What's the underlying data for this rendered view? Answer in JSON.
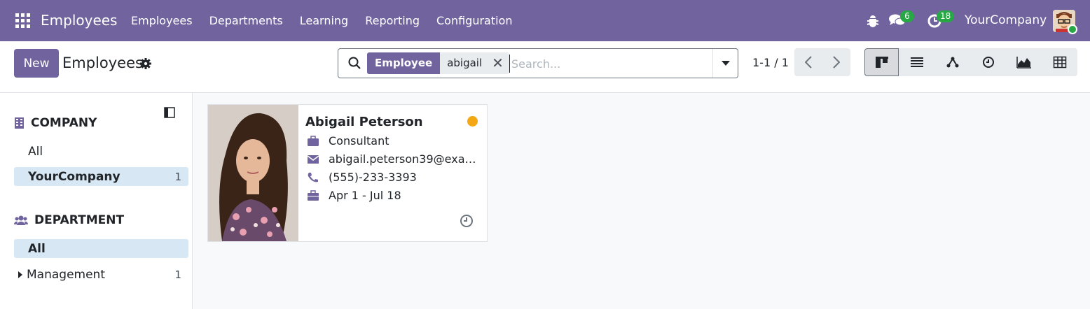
{
  "navbar": {
    "app_name": "Employees",
    "menu": [
      "Employees",
      "Departments",
      "Learning",
      "Reporting",
      "Configuration"
    ],
    "messages_count": "6",
    "activities_count": "18",
    "company": "YourCompany"
  },
  "control": {
    "new_label": "New",
    "breadcrumb": "Employees",
    "search": {
      "facet_name": "Employee",
      "facet_value": "abigail",
      "placeholder": "Search..."
    },
    "pager": "1-1 / 1"
  },
  "sidebar": {
    "company_header": "COMPANY",
    "company_items": [
      {
        "label": "All",
        "count": ""
      },
      {
        "label": "YourCompany",
        "count": "1"
      }
    ],
    "department_header": "DEPARTMENT",
    "department_items": [
      {
        "label": "All",
        "count": ""
      },
      {
        "label": "Management",
        "count": "1"
      }
    ]
  },
  "card": {
    "name": "Abigail Peterson",
    "job": "Consultant",
    "email": "abigail.peterson39@exa…",
    "phone": "(555)-233-3393",
    "dates": "Apr 1 - Jul 18"
  },
  "colors": {
    "brand": "#71639e",
    "status": "#f3a712",
    "badge": "#28a745"
  }
}
